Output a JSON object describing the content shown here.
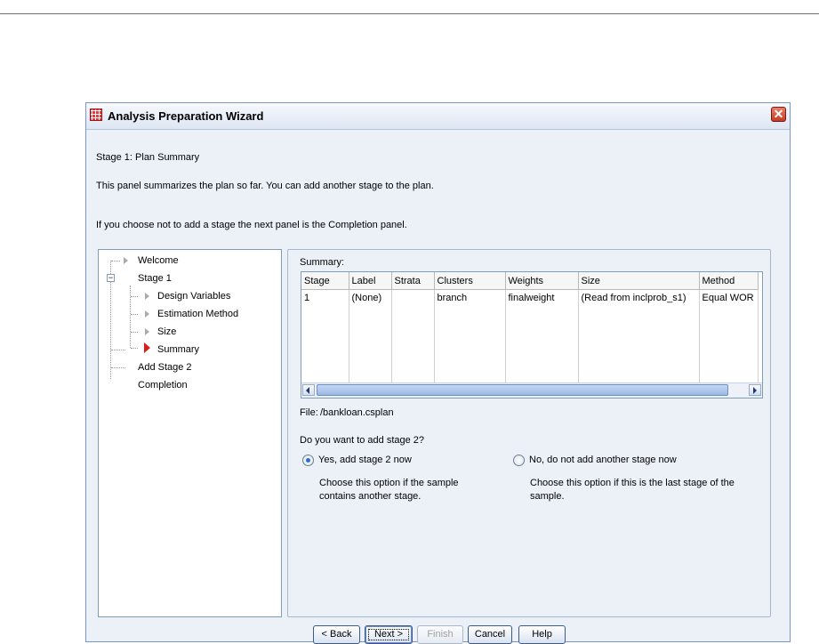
{
  "window": {
    "title": "Analysis Preparation Wizard",
    "close_label": "✕"
  },
  "heading": "Stage 1: Plan Summary",
  "description": "This panel summarizes the plan so far. You can add another stage to the plan.",
  "note": "If you choose not to add a stage the next panel is the Completion panel.",
  "tree": {
    "welcome": "Welcome",
    "stage1": "Stage 1",
    "design_variables": "Design Variables",
    "estimation_method": "Estimation Method",
    "size": "Size",
    "summary": "Summary",
    "add_stage2": "Add Stage 2",
    "completion": "Completion"
  },
  "summary": {
    "label": "Summary:",
    "columns": [
      "Stage",
      "Label",
      "Strata",
      "Clusters",
      "Weights",
      "Size",
      "Method"
    ],
    "rows": [
      [
        "1",
        "(None)",
        "",
        "branch",
        "finalweight",
        "(Read from inclprob_s1)",
        "Equal WOR"
      ]
    ]
  },
  "file": {
    "label": "File:",
    "value": "/bankloan.csplan"
  },
  "question": "Do you want to add stage 2?",
  "options": {
    "yes_label": "Yes, add stage 2 now",
    "yes_desc_line1": "Choose this option if the sample",
    "yes_desc_line2": "contains another stage.",
    "no_label": "No, do not add another stage now",
    "no_desc_line1": "Choose this option if this is the last stage of the",
    "no_desc_line2": "sample.",
    "selected": "yes"
  },
  "buttons": {
    "back": "< Back",
    "next": "Next >",
    "finish": "Finish",
    "cancel": "Cancel",
    "help": "Help"
  },
  "colors": {
    "selected_step": "#d42020",
    "dialog_bg": "#ecf1f8",
    "scroll_thumb": "#9ab8e4"
  }
}
